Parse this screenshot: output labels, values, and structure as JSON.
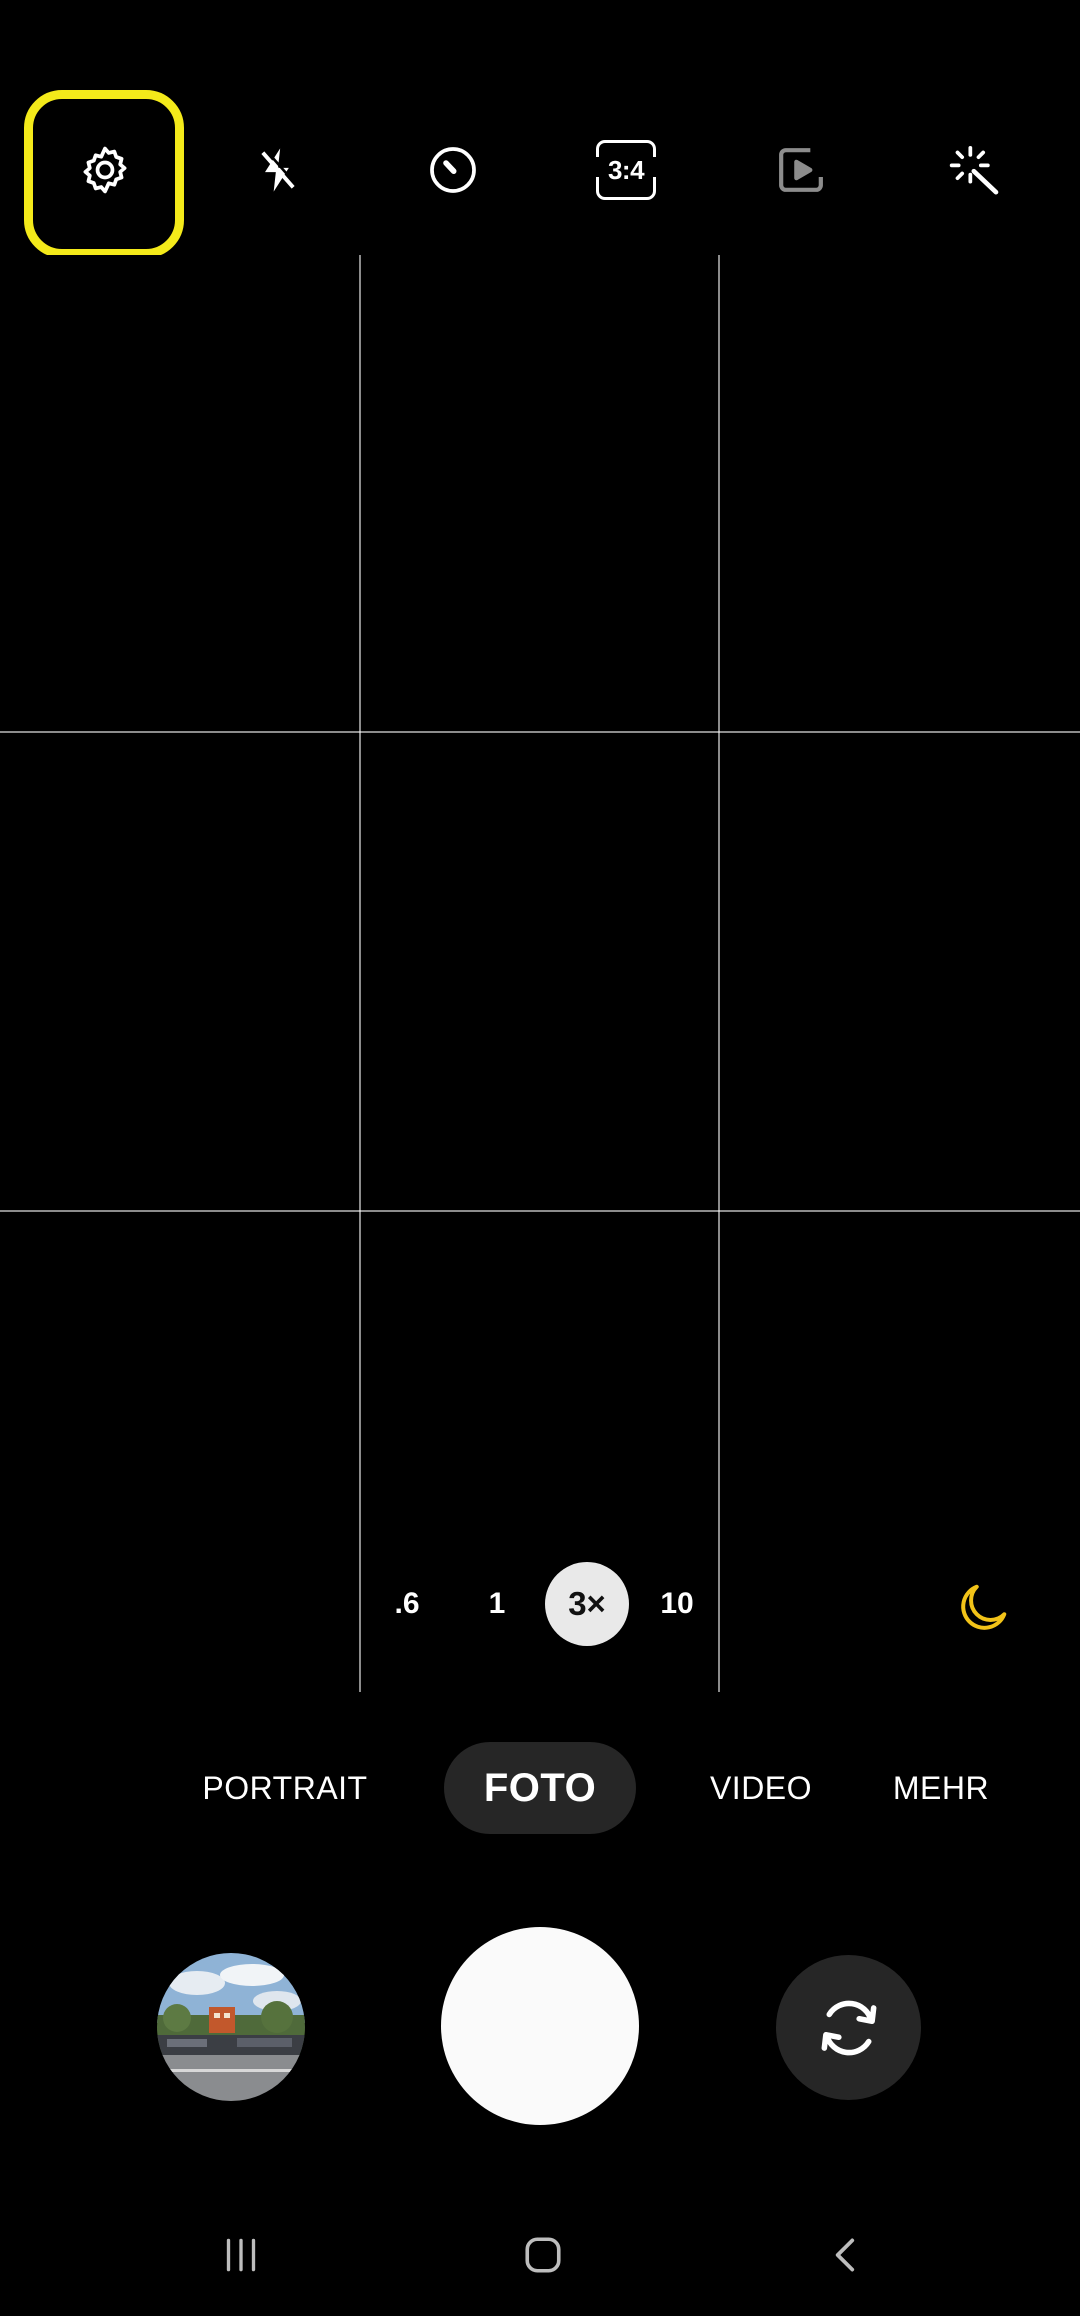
{
  "toolbar": {
    "settings_icon": "gear-icon",
    "flash_icon": "flash-off-icon",
    "timer_icon": "timer-icon",
    "aspect_ratio_label": "3:4",
    "motion_photo_icon": "motion-photo-icon",
    "effects_icon": "magic-wand-icon",
    "highlight_color": "#f4ea1a"
  },
  "zoom": {
    "options": [
      ".6",
      "1",
      "3×",
      "10"
    ],
    "selected": "3×"
  },
  "night_mode": {
    "icon": "moon-icon",
    "color": "#f2c318"
  },
  "modes": {
    "items": [
      "PORTRAIT",
      "FOTO",
      "VIDEO",
      "MEHR"
    ],
    "selected": "FOTO"
  },
  "controls": {
    "gallery_icon": "gallery-thumbnail",
    "shutter_icon": "shutter-icon",
    "switch_camera_icon": "switch-camera-icon"
  },
  "navigation": {
    "recents_icon": "recents-icon",
    "home_icon": "home-icon",
    "back_icon": "back-icon"
  }
}
